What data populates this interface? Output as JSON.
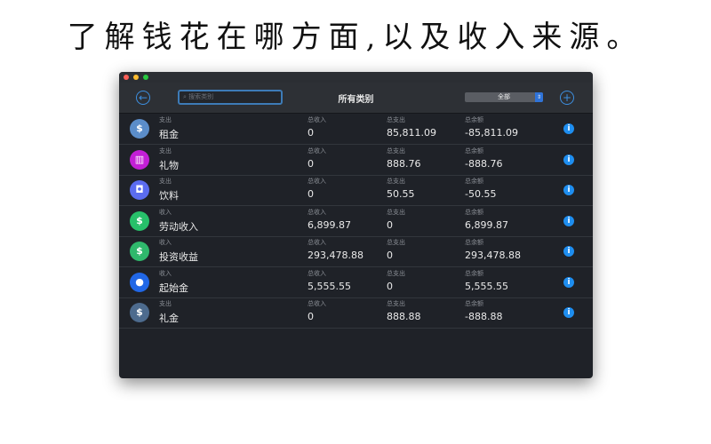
{
  "headline": "了解钱花在哪方面,以及收入来源。",
  "toolbar": {
    "search_placeholder": "搜索类别",
    "title": "所有类别",
    "filter": "全部"
  },
  "columns": {
    "income": "总收入",
    "expense": "总支出",
    "balance": "总余额"
  },
  "rows": [
    {
      "type": "支出",
      "name": "租金",
      "income": "0",
      "expense": "85,811.09",
      "balance": "-85,811.09",
      "icon": "house-dollar-icon",
      "color": "#5b8dc9",
      "glyph": "$"
    },
    {
      "type": "支出",
      "name": "礼物",
      "income": "0",
      "expense": "888.76",
      "balance": "-888.76",
      "icon": "gift-icon",
      "color": "#c21fd6",
      "glyph": "▥"
    },
    {
      "type": "支出",
      "name": "饮料",
      "income": "0",
      "expense": "50.55",
      "balance": "-50.55",
      "icon": "cup-icon",
      "color": "#5b6cf0",
      "glyph": "◘"
    },
    {
      "type": "收入",
      "name": "劳动收入",
      "income": "6,899.87",
      "expense": "0",
      "balance": "6,899.87",
      "icon": "coins-icon",
      "color": "#27c06a",
      "glyph": "$"
    },
    {
      "type": "收入",
      "name": "投资收益",
      "income": "293,478.88",
      "expense": "0",
      "balance": "293,478.88",
      "icon": "coins-icon",
      "color": "#2fb86c",
      "glyph": "$"
    },
    {
      "type": "收入",
      "name": "起始金",
      "income": "5,555.55",
      "expense": "0",
      "balance": "5,555.55",
      "icon": "piggy-bank-icon",
      "color": "#2167e6",
      "glyph": "●"
    },
    {
      "type": "支出",
      "name": "礼金",
      "income": "0",
      "expense": "888.88",
      "balance": "-888.88",
      "icon": "money-bag-icon",
      "color": "#4d6b8e",
      "glyph": "$"
    }
  ]
}
